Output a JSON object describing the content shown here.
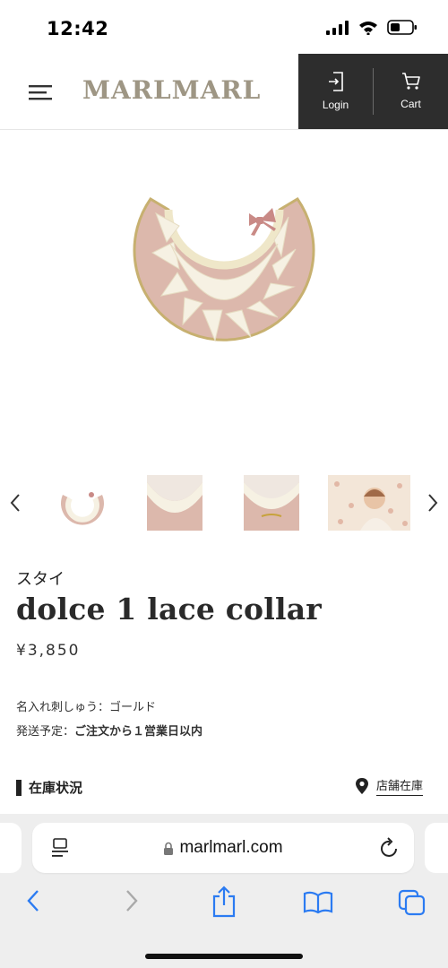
{
  "status_bar": {
    "time": "12:42"
  },
  "header": {
    "logo": "MARLMARL",
    "login_label": "Login",
    "cart_label": "Cart"
  },
  "icons": {
    "menu": "hamburger-menu-icon",
    "login": "login-door-icon",
    "cart": "shopping-cart-icon",
    "prev": "chevron-left-icon",
    "next": "chevron-right-icon",
    "location": "map-pin-icon"
  },
  "product": {
    "category": "スタイ",
    "title": "dolce 1 lace collar",
    "price": "¥3,850",
    "embroidery": "名入れ刺しゅう：ゴールド",
    "shipping_label": "発送予定：",
    "shipping_value": "ご注文から１営業日以内",
    "stock_heading": "在庫状況",
    "store_stock_link": "店舗在庫"
  },
  "browser": {
    "url": "marlmarl.com"
  },
  "colors": {
    "header_dark": "#2d2d2d",
    "logo": "#9e9684",
    "bib_pink": "#dcb8ac",
    "lace": "#f6f1e3",
    "link_blue": "#2b7bf2"
  }
}
